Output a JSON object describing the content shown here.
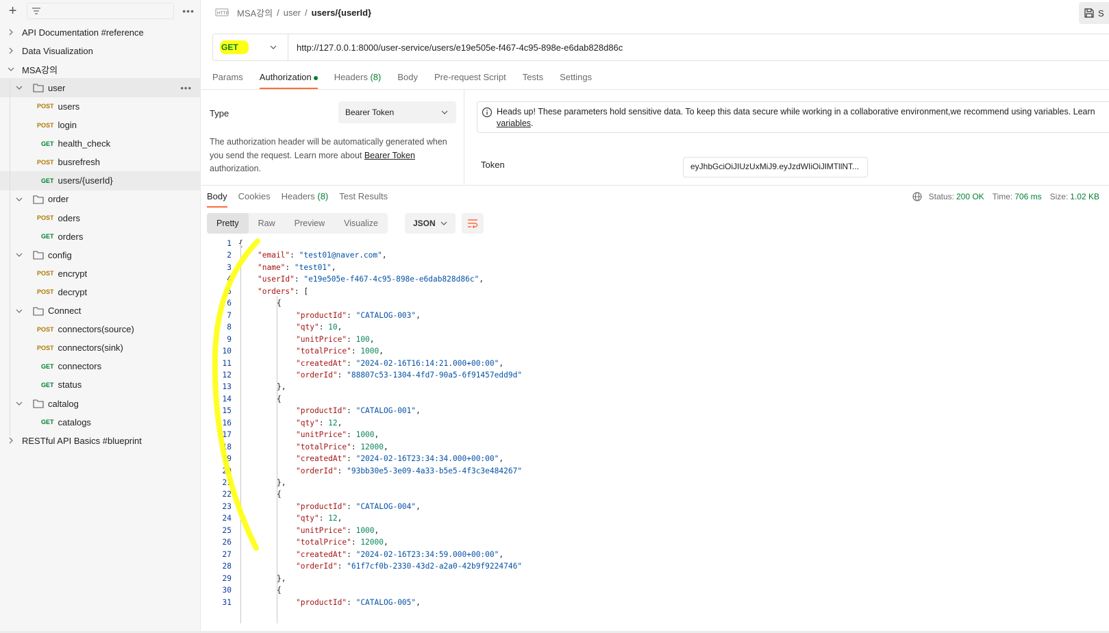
{
  "sidebar": {
    "filter_placeholder": "",
    "items": [
      {
        "type": "collection",
        "label": "API Documentation #reference",
        "expanded": false
      },
      {
        "type": "collection",
        "label": "Data Visualization",
        "expanded": false
      },
      {
        "type": "collection",
        "label": "MSA강의",
        "expanded": true
      },
      {
        "type": "folder",
        "label": "user",
        "expanded": true
      },
      {
        "type": "request",
        "method": "POST",
        "label": "users"
      },
      {
        "type": "request",
        "method": "POST",
        "label": "login"
      },
      {
        "type": "request",
        "method": "GET",
        "label": "health_check"
      },
      {
        "type": "request",
        "method": "POST",
        "label": "busrefresh"
      },
      {
        "type": "request",
        "method": "GET",
        "label": "users/{userId}",
        "active": true
      },
      {
        "type": "folder",
        "label": "order",
        "expanded": true
      },
      {
        "type": "request",
        "method": "POST",
        "label": "oders"
      },
      {
        "type": "request",
        "method": "GET",
        "label": "orders"
      },
      {
        "type": "folder",
        "label": "config",
        "expanded": true
      },
      {
        "type": "request",
        "method": "POST",
        "label": "encrypt"
      },
      {
        "type": "request",
        "method": "POST",
        "label": "decrypt"
      },
      {
        "type": "folder",
        "label": "Connect",
        "expanded": true
      },
      {
        "type": "request",
        "method": "POST",
        "label": "connectors(source)"
      },
      {
        "type": "request",
        "method": "POST",
        "label": "connectors(sink)"
      },
      {
        "type": "request",
        "method": "GET",
        "label": "connectors"
      },
      {
        "type": "request",
        "method": "GET",
        "label": "status"
      },
      {
        "type": "folder",
        "label": "caltalog",
        "expanded": true
      },
      {
        "type": "request",
        "method": "GET",
        "label": "catalogs"
      },
      {
        "type": "collection",
        "label": "RESTful API Basics #blueprint",
        "expanded": false
      }
    ],
    "colors": {
      "post": "#ad7a03",
      "get": "#007f31"
    }
  },
  "breadcrumb": {
    "icon": "http-icon",
    "items": [
      "MSA강의",
      "user"
    ],
    "current": "users/{userId}"
  },
  "save_label": "S",
  "request": {
    "method": "GET",
    "url": "http://127.0.0.1:8000/user-service/users/e19e505e-f467-4c95-898e-e6dab828d86c"
  },
  "request_tabs": [
    {
      "label": "Params"
    },
    {
      "label": "Authorization",
      "active": true,
      "dot": true
    },
    {
      "label": "Headers",
      "count": "(8)"
    },
    {
      "label": "Body"
    },
    {
      "label": "Pre-request Script"
    },
    {
      "label": "Tests"
    },
    {
      "label": "Settings"
    }
  ],
  "auth": {
    "type_label": "Type",
    "type_value": "Bearer Token",
    "desc_1": "The authorization header will be automatically generated when you send the request. Learn more about ",
    "desc_link": "Bearer Token",
    "desc_2": " authorization.",
    "heads_up_1": "Heads up! These parameters hold sensitive data. To keep this data secure while working in a collaborative environment,we recommend using variables. Learn",
    "heads_up_link": "variables",
    "heads_up_2": ".",
    "token_label": "Token",
    "token_value": "eyJhbGciOiJIUzUxMiJ9.eyJzdWIiOiJlMTllNT..."
  },
  "response_tabs": [
    {
      "label": "Body",
      "active": true
    },
    {
      "label": "Cookies"
    },
    {
      "label": "Headers",
      "count": "(8)"
    },
    {
      "label": "Test Results"
    }
  ],
  "response_meta": {
    "status_label": "Status:",
    "status_value": "200 OK",
    "time_label": "Time:",
    "time_value": "706 ms",
    "size_label": "Size:",
    "size_value": "1.02 KB"
  },
  "view_modes": [
    {
      "label": "Pretty",
      "active": true
    },
    {
      "label": "Raw"
    },
    {
      "label": "Preview"
    },
    {
      "label": "Visualize"
    }
  ],
  "format": "JSON",
  "code_lines": [
    {
      "n": "1",
      "indent": 0,
      "parts": [
        [
          "p",
          "{"
        ]
      ]
    },
    {
      "n": "2",
      "indent": 1,
      "parts": [
        [
          "k",
          "\"email\""
        ],
        [
          "p",
          ": "
        ],
        [
          "s",
          "\"test01@naver.com\""
        ],
        [
          "p",
          ","
        ]
      ]
    },
    {
      "n": "3",
      "indent": 1,
      "parts": [
        [
          "k",
          "\"name\""
        ],
        [
          "p",
          ": "
        ],
        [
          "s",
          "\"test01\""
        ],
        [
          "p",
          ","
        ]
      ]
    },
    {
      "n": "4",
      "indent": 1,
      "parts": [
        [
          "k",
          "\"userId\""
        ],
        [
          "p",
          ": "
        ],
        [
          "s",
          "\"e19e505e-f467-4c95-898e-e6dab828d86c\""
        ],
        [
          "p",
          ","
        ]
      ]
    },
    {
      "n": "5",
      "indent": 1,
      "parts": [
        [
          "k",
          "\"orders\""
        ],
        [
          "p",
          ": ["
        ]
      ]
    },
    {
      "n": "6",
      "indent": 2,
      "parts": [
        [
          "p",
          "{"
        ]
      ]
    },
    {
      "n": "7",
      "indent": 3,
      "parts": [
        [
          "k",
          "\"productId\""
        ],
        [
          "p",
          ": "
        ],
        [
          "s",
          "\"CATALOG-003\""
        ],
        [
          "p",
          ","
        ]
      ]
    },
    {
      "n": "8",
      "indent": 3,
      "parts": [
        [
          "k",
          "\"qty\""
        ],
        [
          "p",
          ": "
        ],
        [
          "n",
          "10"
        ],
        [
          "p",
          ","
        ]
      ]
    },
    {
      "n": "9",
      "indent": 3,
      "parts": [
        [
          "k",
          "\"unitPrice\""
        ],
        [
          "p",
          ": "
        ],
        [
          "n",
          "100"
        ],
        [
          "p",
          ","
        ]
      ]
    },
    {
      "n": "10",
      "indent": 3,
      "parts": [
        [
          "k",
          "\"totalPrice\""
        ],
        [
          "p",
          ": "
        ],
        [
          "n",
          "1000"
        ],
        [
          "p",
          ","
        ]
      ]
    },
    {
      "n": "11",
      "indent": 3,
      "parts": [
        [
          "k",
          "\"createdAt\""
        ],
        [
          "p",
          ": "
        ],
        [
          "s",
          "\"2024-02-16T16:14:21.000+00:00\""
        ],
        [
          "p",
          ","
        ]
      ]
    },
    {
      "n": "12",
      "indent": 3,
      "parts": [
        [
          "k",
          "\"orderId\""
        ],
        [
          "p",
          ": "
        ],
        [
          "s",
          "\"88807c53-1304-4fd7-90a5-6f91457edd9d\""
        ]
      ]
    },
    {
      "n": "13",
      "indent": 2,
      "parts": [
        [
          "p",
          "},"
        ]
      ]
    },
    {
      "n": "14",
      "indent": 2,
      "parts": [
        [
          "p",
          "{"
        ]
      ]
    },
    {
      "n": "15",
      "indent": 3,
      "parts": [
        [
          "k",
          "\"productId\""
        ],
        [
          "p",
          ": "
        ],
        [
          "s",
          "\"CATALOG-001\""
        ],
        [
          "p",
          ","
        ]
      ]
    },
    {
      "n": "16",
      "indent": 3,
      "parts": [
        [
          "k",
          "\"qty\""
        ],
        [
          "p",
          ": "
        ],
        [
          "n",
          "12"
        ],
        [
          "p",
          ","
        ]
      ]
    },
    {
      "n": "17",
      "indent": 3,
      "parts": [
        [
          "k",
          "\"unitPrice\""
        ],
        [
          "p",
          ": "
        ],
        [
          "n",
          "1000"
        ],
        [
          "p",
          ","
        ]
      ]
    },
    {
      "n": "18",
      "indent": 3,
      "parts": [
        [
          "k",
          "\"totalPrice\""
        ],
        [
          "p",
          ": "
        ],
        [
          "n",
          "12000"
        ],
        [
          "p",
          ","
        ]
      ]
    },
    {
      "n": "19",
      "indent": 3,
      "parts": [
        [
          "k",
          "\"createdAt\""
        ],
        [
          "p",
          ": "
        ],
        [
          "s",
          "\"2024-02-16T23:34:34.000+00:00\""
        ],
        [
          "p",
          ","
        ]
      ]
    },
    {
      "n": "20",
      "indent": 3,
      "parts": [
        [
          "k",
          "\"orderId\""
        ],
        [
          "p",
          ": "
        ],
        [
          "s",
          "\"93bb30e5-3e09-4a33-b5e5-4f3c3e484267\""
        ]
      ]
    },
    {
      "n": "21",
      "indent": 2,
      "parts": [
        [
          "p",
          "},"
        ]
      ]
    },
    {
      "n": "22",
      "indent": 2,
      "parts": [
        [
          "p",
          "{"
        ]
      ]
    },
    {
      "n": "23",
      "indent": 3,
      "parts": [
        [
          "k",
          "\"productId\""
        ],
        [
          "p",
          ": "
        ],
        [
          "s",
          "\"CATALOG-004\""
        ],
        [
          "p",
          ","
        ]
      ]
    },
    {
      "n": "24",
      "indent": 3,
      "parts": [
        [
          "k",
          "\"qty\""
        ],
        [
          "p",
          ": "
        ],
        [
          "n",
          "12"
        ],
        [
          "p",
          ","
        ]
      ]
    },
    {
      "n": "25",
      "indent": 3,
      "parts": [
        [
          "k",
          "\"unitPrice\""
        ],
        [
          "p",
          ": "
        ],
        [
          "n",
          "1000"
        ],
        [
          "p",
          ","
        ]
      ]
    },
    {
      "n": "26",
      "indent": 3,
      "parts": [
        [
          "k",
          "\"totalPrice\""
        ],
        [
          "p",
          ": "
        ],
        [
          "n",
          "12000"
        ],
        [
          "p",
          ","
        ]
      ]
    },
    {
      "n": "27",
      "indent": 3,
      "parts": [
        [
          "k",
          "\"createdAt\""
        ],
        [
          "p",
          ": "
        ],
        [
          "s",
          "\"2024-02-16T23:34:59.000+00:00\""
        ],
        [
          "p",
          ","
        ]
      ]
    },
    {
      "n": "28",
      "indent": 3,
      "parts": [
        [
          "k",
          "\"orderId\""
        ],
        [
          "p",
          ": "
        ],
        [
          "s",
          "\"61f7cf0b-2330-43d2-a2a0-42b9f9224746\""
        ]
      ]
    },
    {
      "n": "29",
      "indent": 2,
      "parts": [
        [
          "p",
          "},"
        ]
      ]
    },
    {
      "n": "30",
      "indent": 2,
      "parts": [
        [
          "p",
          "{"
        ]
      ]
    },
    {
      "n": "31",
      "indent": 3,
      "parts": [
        [
          "k",
          "\"productId\""
        ],
        [
          "p",
          ": "
        ],
        [
          "s",
          "\"CATALOG-005\""
        ],
        [
          "p",
          ","
        ]
      ]
    }
  ],
  "colors": {
    "accent": "#ff6c37",
    "highlight": "#ffff14",
    "success": "#007f31"
  }
}
